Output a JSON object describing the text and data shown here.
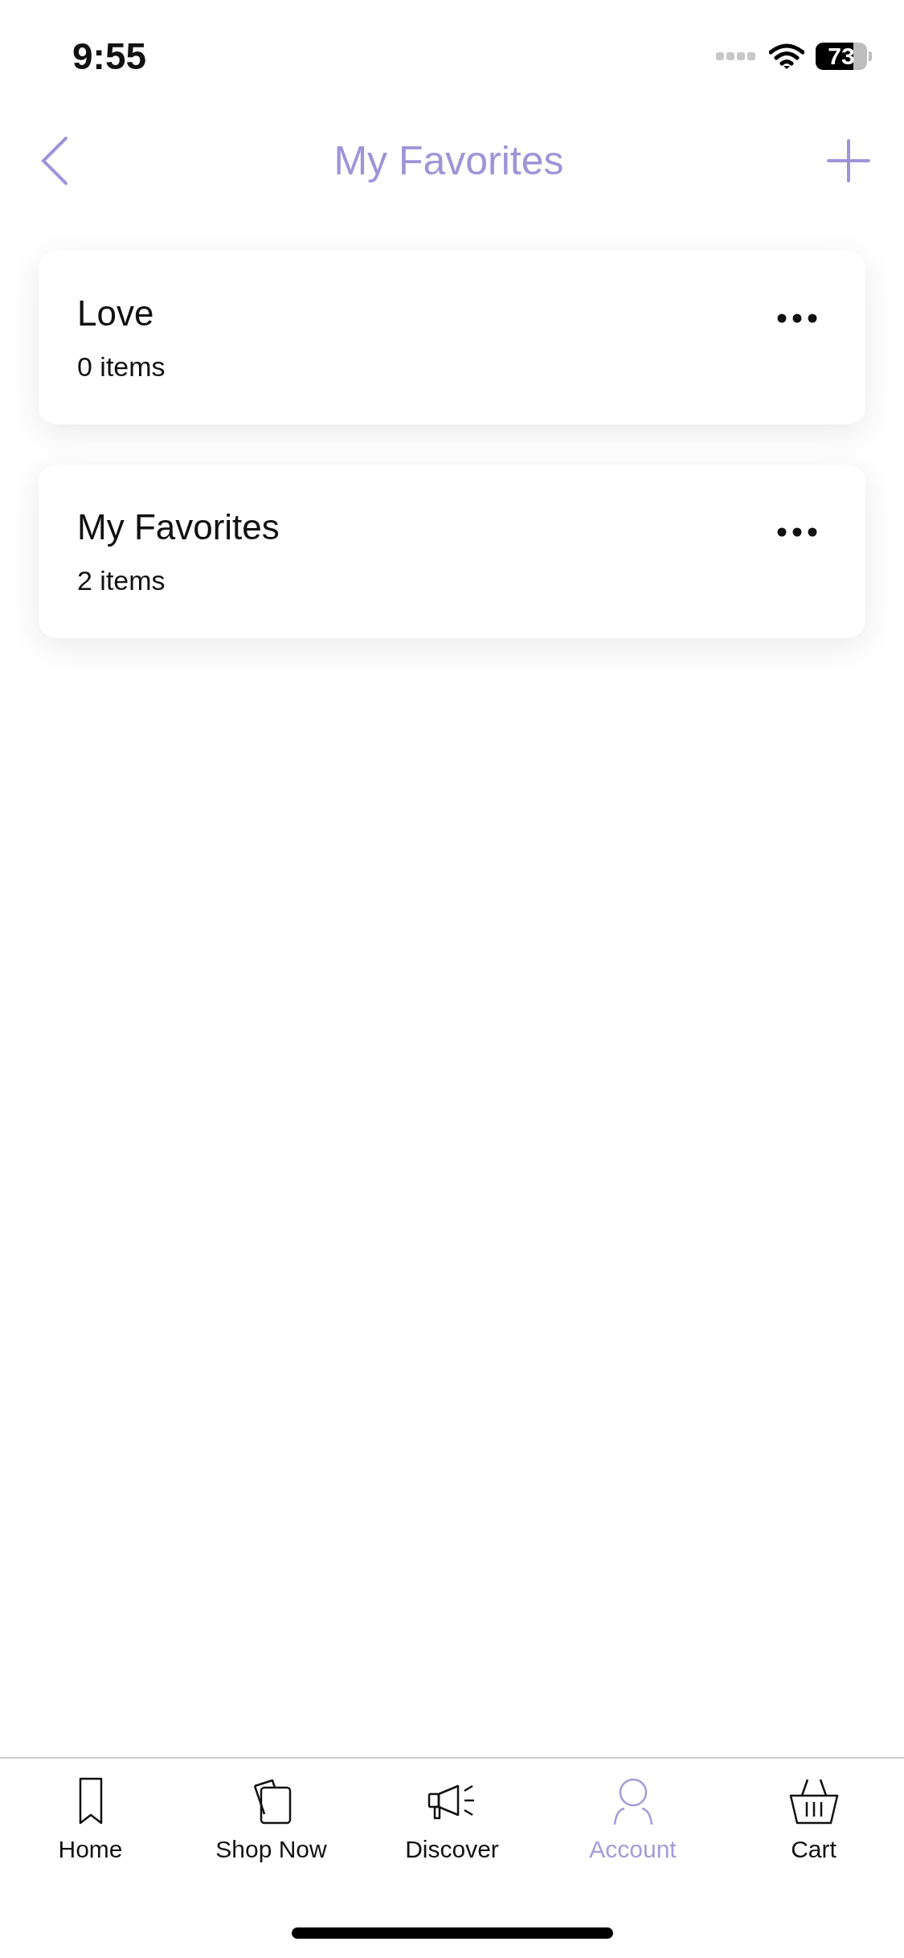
{
  "status_bar": {
    "time": "9:55",
    "battery": "73"
  },
  "nav": {
    "title": "My Favorites"
  },
  "lists": [
    {
      "name": "Love",
      "count": "0 items"
    },
    {
      "name": "My Favorites",
      "count": "2 items"
    }
  ],
  "tabs": [
    {
      "label": "Home",
      "kind": "home",
      "selected": false
    },
    {
      "label": "Shop Now",
      "kind": "shop",
      "selected": false
    },
    {
      "label": "Discover",
      "kind": "discover",
      "selected": false
    },
    {
      "label": "Account",
      "kind": "account",
      "selected": true
    },
    {
      "label": "Cart",
      "kind": "cart",
      "selected": false
    }
  ]
}
